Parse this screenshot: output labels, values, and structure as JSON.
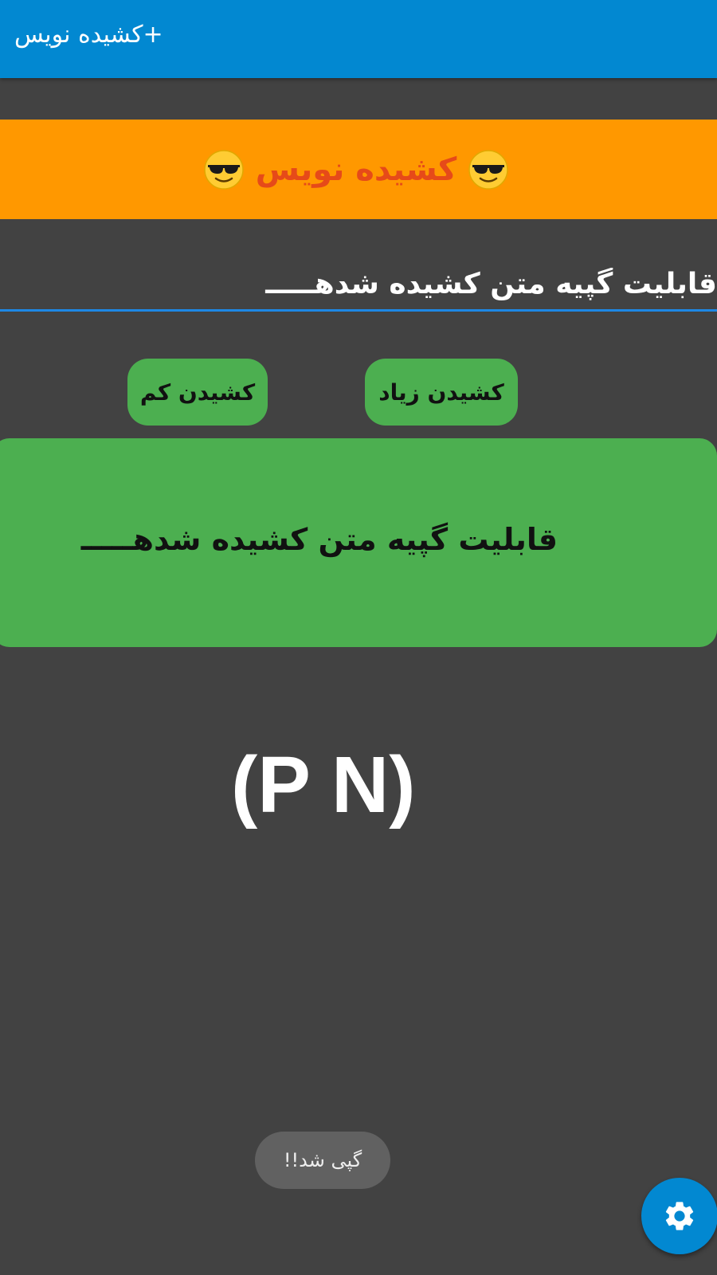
{
  "app_bar": {
    "title": "کشیده نویس+",
    "background": "#0288D1"
  },
  "banner": {
    "text": "کشیده نویس",
    "emoji": "smiling-face-with-sunglasses-icon",
    "background": "#FF9800",
    "text_color": "#E64A19"
  },
  "input": {
    "value": "قابلیت گپیه متن کشیده شدهـــــ"
  },
  "buttons": {
    "more_label": "کشیدن زیاد",
    "less_label": "کشیدن کم",
    "color": "#4CAF50"
  },
  "output": {
    "text": "قابلیت گپیه متن کشیده شدهـــــ"
  },
  "brand": {
    "text": "(P N)"
  },
  "toast": {
    "text": "گپی شد!!"
  },
  "fab": {
    "icon": "gear-icon"
  }
}
